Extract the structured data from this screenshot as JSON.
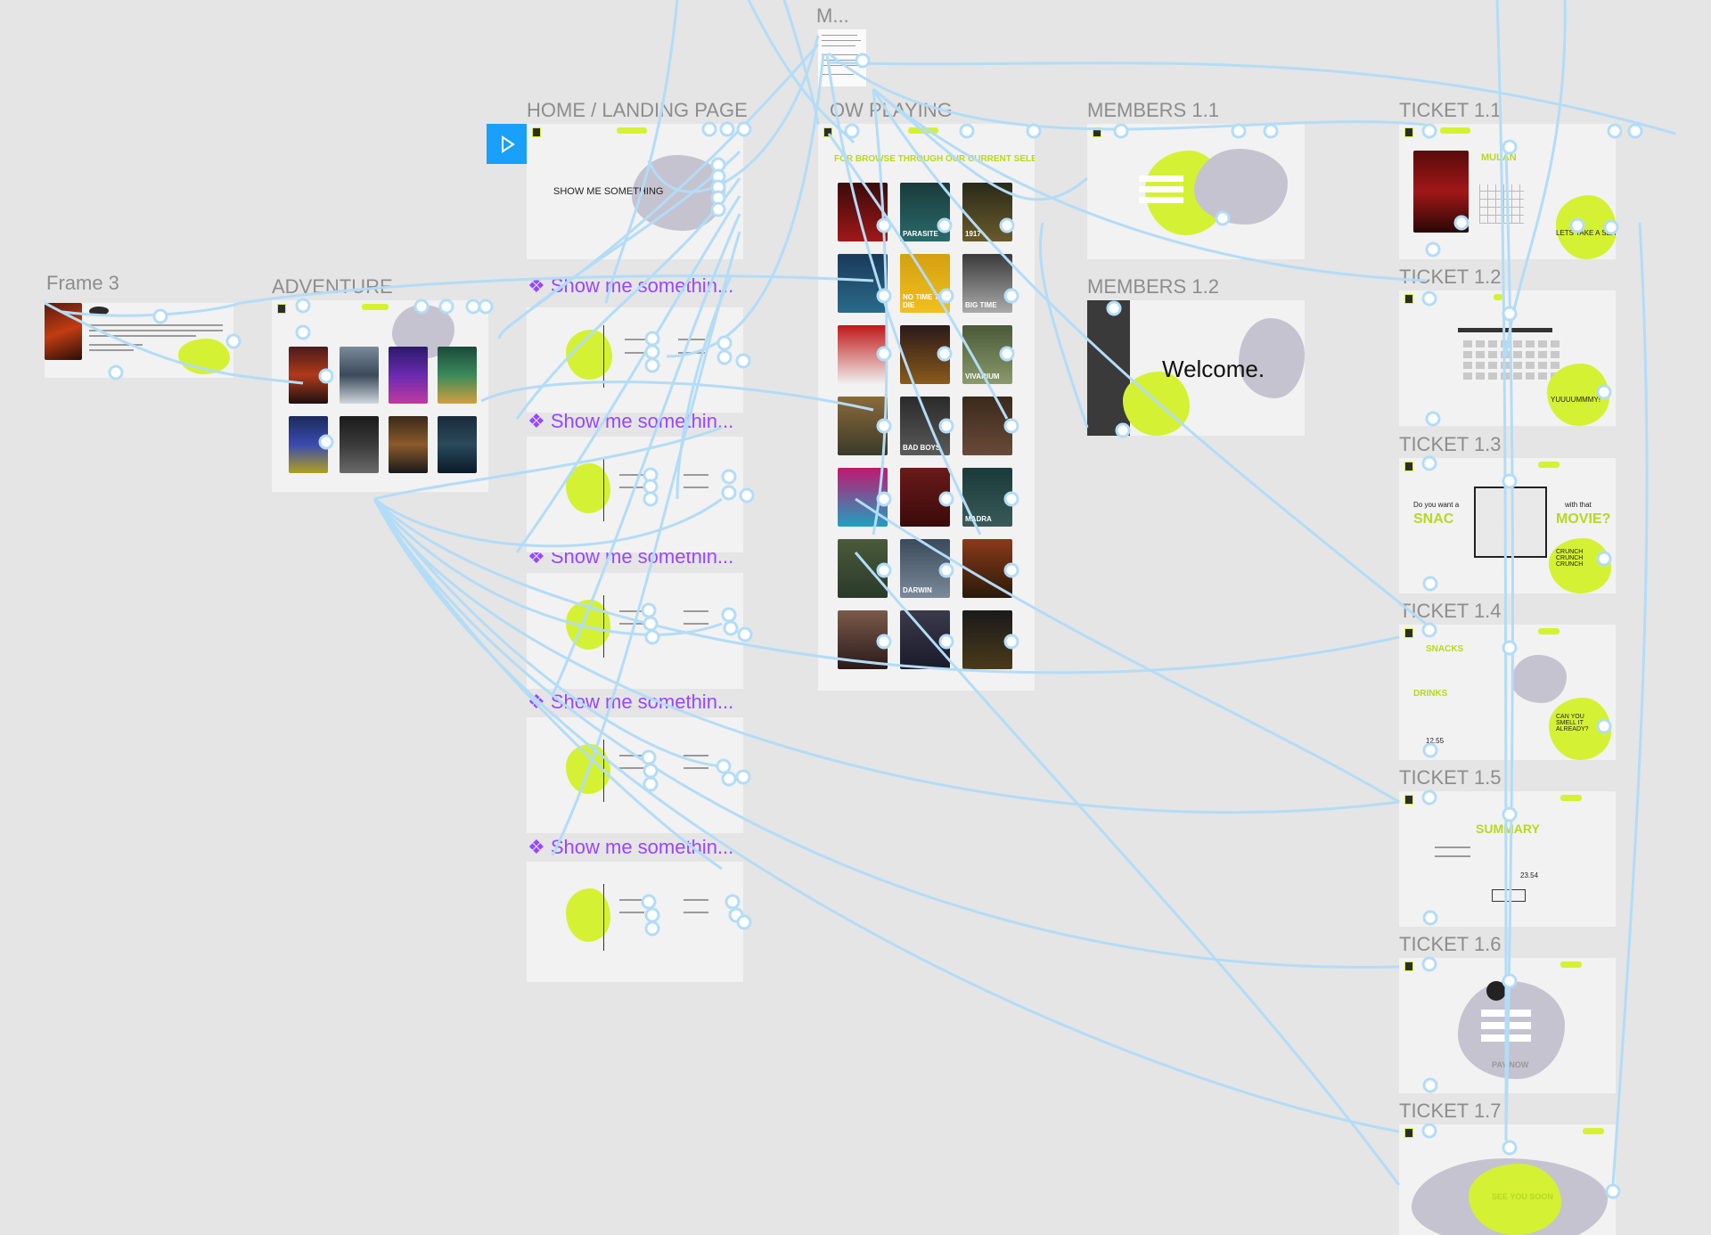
{
  "canvas": {
    "frames": [
      {
        "id": "frame3",
        "label": "Frame 3"
      },
      {
        "id": "adventure",
        "label": "ADVENTURE"
      },
      {
        "id": "home",
        "label": "HOME / LANDING PAGE"
      },
      {
        "id": "nowplaying",
        "label": "OW PLAYING"
      },
      {
        "id": "m",
        "label": "M..."
      },
      {
        "id": "members11",
        "label": "MEMBERS 1.1"
      },
      {
        "id": "members12",
        "label": "MEMBERS 1.2"
      },
      {
        "id": "t11",
        "label": "TICKET 1.1"
      },
      {
        "id": "t12",
        "label": "TICKET 1.2"
      },
      {
        "id": "t13",
        "label": "TICKET 1.3"
      },
      {
        "id": "t14",
        "label": "TICKET 1.4"
      },
      {
        "id": "t15",
        "label": "TICKET 1.5"
      },
      {
        "id": "t16",
        "label": "TICKET 1.6"
      },
      {
        "id": "t17",
        "label": "TICKET 1.7"
      }
    ],
    "components": [
      "Show me somethin...",
      "Show me somethin...",
      "Show me somethin...",
      "Show me somethin...",
      "Show me somethin..."
    ]
  },
  "home": {
    "headline": "SHOW ME SOMETHING"
  },
  "nowplaying": {
    "header": "FOR BROWSE THROUGH OUR CURRENT SELECTION"
  },
  "members12": {
    "welcome": "Welcome."
  },
  "tickets": {
    "t11_title": "MULAN",
    "t11_cta": "LETS TAKE A SEAT",
    "t12_cta": "YUUUUMMMY!",
    "t13_left": "Do you want a",
    "t13_snac": "SNAC",
    "t13_right": "with that",
    "t13_movie": "MOVIE?",
    "t13_crunch": "CRUNCH CRUNCH CRUNCH",
    "t14_snacks": "SNACKS",
    "t14_drinks": "DRINKS",
    "t14_total": "12.55",
    "t14_cta": "CAN YOU SMELL IT ALREADY?",
    "t15_title": "SUMMARY",
    "t15_total": "23.54",
    "t16_cta": "PAY NOW",
    "t17_cta": "SEE YOU SOON"
  },
  "poster_titles": [
    "PARASITE",
    "1917",
    "BIG TIME",
    "VIVARIUM",
    "BAD BOYS",
    "NO TIME TO DIE",
    "MADRA",
    "DARWIN"
  ],
  "colors": {
    "accent": "#d4f233",
    "wire": "#b3dcf7",
    "prototype": "#18a0fb",
    "component": "#9747ff"
  },
  "play_icon": "play-icon"
}
